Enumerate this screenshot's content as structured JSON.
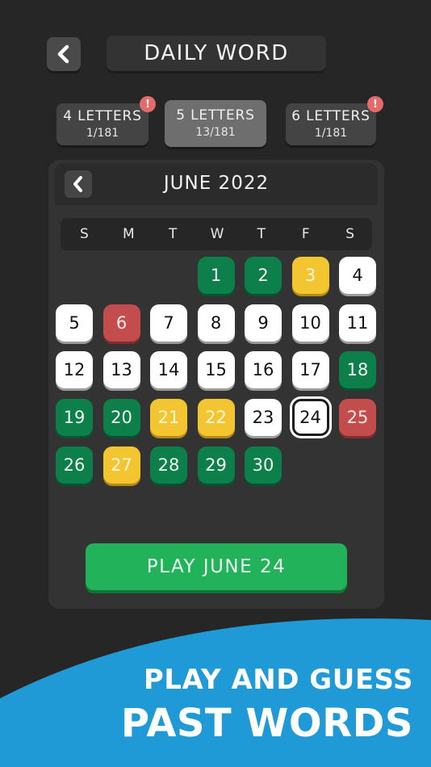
{
  "header": {
    "title": "DAILY WORD",
    "back_icon": "chevron-left-icon"
  },
  "modes": [
    {
      "label": "4 LETTERS",
      "progress": "1/181",
      "alert": "!",
      "active": false
    },
    {
      "label": "5 LETTERS",
      "progress": "13/181",
      "alert": "",
      "active": true
    },
    {
      "label": "6 LETTERS",
      "progress": "1/181",
      "alert": "!",
      "active": false
    }
  ],
  "calendar": {
    "month_label": "JUNE 2022",
    "weekdays": [
      "S",
      "M",
      "T",
      "W",
      "T",
      "F",
      "S"
    ],
    "first_weekday_index": 3,
    "days": [
      {
        "n": "1",
        "status": "green"
      },
      {
        "n": "2",
        "status": "green"
      },
      {
        "n": "3",
        "status": "yellow"
      },
      {
        "n": "4",
        "status": "white"
      },
      {
        "n": "5",
        "status": "white"
      },
      {
        "n": "6",
        "status": "red"
      },
      {
        "n": "7",
        "status": "white"
      },
      {
        "n": "8",
        "status": "white"
      },
      {
        "n": "9",
        "status": "white"
      },
      {
        "n": "10",
        "status": "white"
      },
      {
        "n": "11",
        "status": "white"
      },
      {
        "n": "12",
        "status": "white"
      },
      {
        "n": "13",
        "status": "white"
      },
      {
        "n": "14",
        "status": "white"
      },
      {
        "n": "15",
        "status": "white"
      },
      {
        "n": "16",
        "status": "white"
      },
      {
        "n": "17",
        "status": "white"
      },
      {
        "n": "18",
        "status": "green"
      },
      {
        "n": "19",
        "status": "green"
      },
      {
        "n": "20",
        "status": "green"
      },
      {
        "n": "21",
        "status": "yellow"
      },
      {
        "n": "22",
        "status": "yellow"
      },
      {
        "n": "23",
        "status": "white"
      },
      {
        "n": "24",
        "status": "white",
        "selected": true
      },
      {
        "n": "25",
        "status": "red"
      },
      {
        "n": "26",
        "status": "green"
      },
      {
        "n": "27",
        "status": "yellow"
      },
      {
        "n": "28",
        "status": "green"
      },
      {
        "n": "29",
        "status": "green"
      },
      {
        "n": "30",
        "status": "green"
      }
    ]
  },
  "play_button": {
    "label": "PLAY JUNE 24"
  },
  "promo": {
    "line1": "PLAY AND GUESS",
    "line2": "PAST WORDS"
  },
  "colors": {
    "background": "#262626",
    "panel": "#333333",
    "green": "#0d7f4a",
    "yellow": "#f2c531",
    "red": "#c34d4c",
    "play": "#22b35a",
    "wave": "#1f9ad6"
  }
}
